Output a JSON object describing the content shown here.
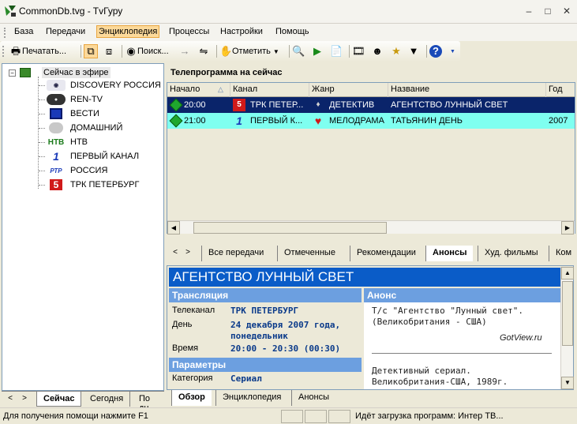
{
  "window": {
    "title": "CommonDb.tvg - TvГуру"
  },
  "menu": [
    "База",
    "Передачи",
    "Энциклопедия",
    "Процессы",
    "Настройки",
    "Помощь"
  ],
  "toolbar": {
    "print_label": "Печатать...",
    "search_label": "Поиск...",
    "mark_label": "Отметить"
  },
  "tree": {
    "root_label": "Сейчас в эфире",
    "channels": [
      {
        "name": "DISCOVERY РОССИЯ",
        "icon": "discovery-logo-icon"
      },
      {
        "name": "REN-TV",
        "icon": "ren-tv-logo-icon"
      },
      {
        "name": "ВЕСТИ",
        "icon": "vesti-logo-icon"
      },
      {
        "name": "ДОМАШНИЙ",
        "icon": "domashny-logo-icon"
      },
      {
        "name": "НТВ",
        "icon": "ntv-logo-icon",
        "logo_text": "НТВ"
      },
      {
        "name": "ПЕРВЫЙ КАНАЛ",
        "icon": "perviy-logo-icon",
        "logo_text": "1"
      },
      {
        "name": "РОССИЯ",
        "icon": "rtr-logo-icon",
        "logo_text": "РТР"
      },
      {
        "name": "ТРК ПЕТЕРБУРГ",
        "icon": "channel5-logo-icon",
        "logo_text": "5"
      }
    ]
  },
  "left_tabs": [
    "Сейчас",
    "Сегодня",
    "По дн"
  ],
  "programs": {
    "header": "Телепрограмма на сейчас",
    "columns": [
      "Начало",
      "Канал",
      "Жанр",
      "Название",
      "Год"
    ],
    "rows": [
      {
        "start": "20:00",
        "channel": "ТРК ПЕТЕР...",
        "genre": "ДЕТЕКТИВ",
        "title": "АГЕНТСТВО ЛУННЫЙ СВЕТ",
        "year": ""
      },
      {
        "start": "21:00",
        "channel": "ПЕРВЫЙ К...",
        "genre": "МЕЛОДРАМА",
        "title": "ТАТЬЯНИН ДЕНЬ",
        "year": "2007"
      }
    ]
  },
  "program_tabs": [
    "Все передачи",
    "Отмеченные",
    "Рекомендации",
    "Анонсы",
    "Худ. фильмы",
    "Ком"
  ],
  "detail": {
    "title": "АГЕНТСТВО ЛУННЫЙ СВЕТ",
    "broadcast_header": "Трансляция",
    "fields": [
      {
        "label": "Телеканал",
        "value": "ТРК ПЕТЕРБУРГ"
      },
      {
        "label": "День",
        "value": "24 декабря 2007 года,",
        "value2": "понедельник"
      },
      {
        "label": "Время",
        "value": "20:00 - 20:30 (00:30)"
      }
    ],
    "params_header": "Параметры",
    "category_label": "Категория",
    "category_value": "Сериал",
    "anons_header": "Анонс",
    "anons_line1": "Т/с \"Агентство \"Лунный свет\".",
    "anons_line2": "(Великобритания - США)",
    "source": "GotView.ru",
    "desc_line1": "Детективный сериал.",
    "desc_line2": "Великобритания-США, 1989г."
  },
  "detail_tabs": [
    "Обзор",
    "Энциклопедия",
    "Анонсы"
  ],
  "status": {
    "help": "Для получения помощи нажмите F1",
    "loading": "Идёт загрузка программ: Интер ТВ..."
  }
}
